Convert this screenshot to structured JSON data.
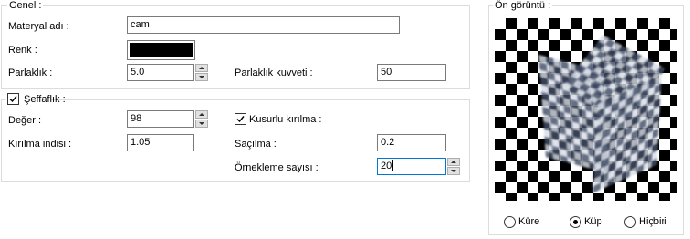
{
  "general": {
    "legend": "Genel :",
    "material_name_label": "Materyal adı :",
    "material_name_value": "cam",
    "color_label": "Renk :",
    "color_value": "#000000",
    "brightness_label": "Parlaklık :",
    "brightness_value": "5.0",
    "brightness_strength_label": "Parlaklık kuvveti :",
    "brightness_strength_value": "50"
  },
  "transparency": {
    "checkbox_label": "Şeffaflık :",
    "checked": true,
    "value_label": "Değer :",
    "value": "98",
    "refraction_index_label": "Kırılma indisi :",
    "refraction_index_value": "1.05",
    "imperfect_refraction_label": "Kusurlu kırılma :",
    "imperfect_refraction_checked": true,
    "scatter_label": "Saçılma :",
    "scatter_value": "0.2",
    "sample_count_label": "Örnekleme sayısı :",
    "sample_count_value": "20"
  },
  "preview": {
    "legend": "Ön görüntü :",
    "shape_options": [
      {
        "label": "Küre",
        "selected": false
      },
      {
        "label": "Küp",
        "selected": true
      },
      {
        "label": "Hiçbiri",
        "selected": false
      }
    ]
  }
}
